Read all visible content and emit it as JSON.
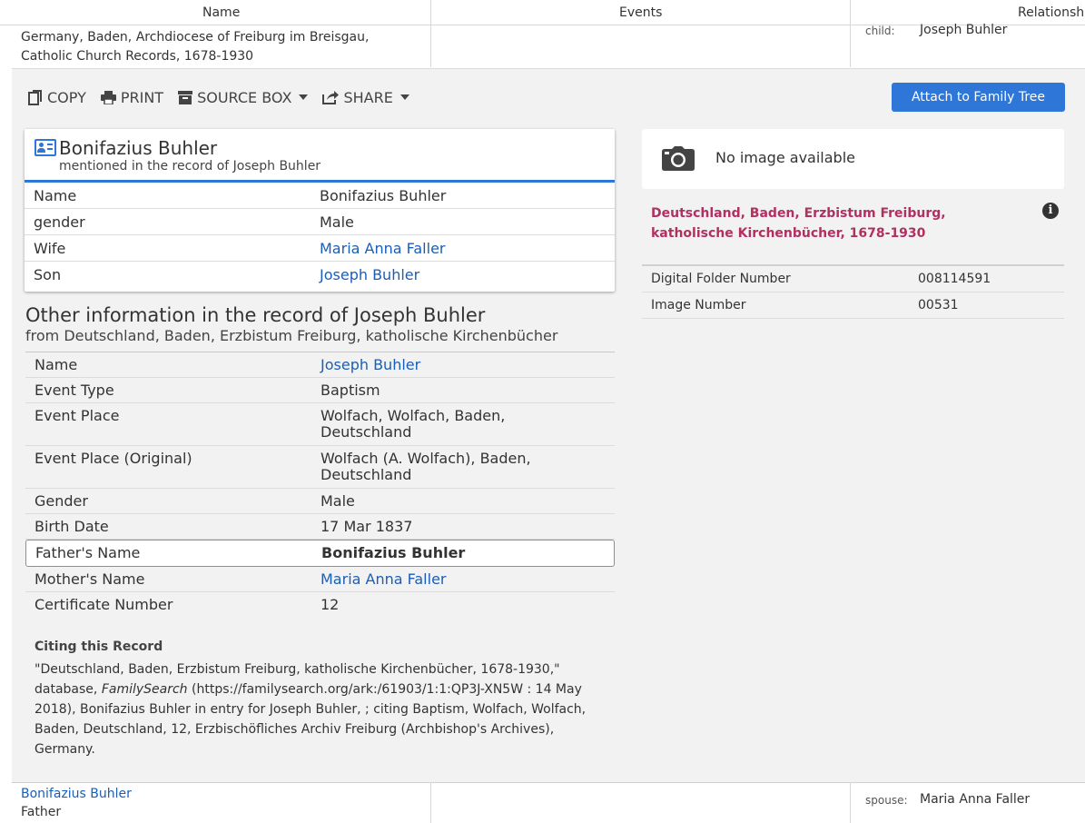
{
  "columns": {
    "name": "Name",
    "events": "Events",
    "relationships": "Relationsh"
  },
  "top_row": {
    "name_line1": "Germany, Baden, Archdiocese of Freiburg im Breisgau,",
    "name_line2": "Catholic Church Records, 1678-1930",
    "relation_label": "child:",
    "relation_value": "Joseph Buhler"
  },
  "toolbar": {
    "copy": "COPY",
    "print": "PRINT",
    "source_box": "SOURCE BOX",
    "share": "SHARE",
    "attach": "Attach to Family Tree"
  },
  "person_card": {
    "title": "Bonifazius Buhler",
    "subtitle": "mentioned in the record of Joseph Buhler",
    "rows": [
      {
        "label": "Name",
        "value": "Bonifazius Buhler",
        "link": false
      },
      {
        "label": "gender",
        "value": "Male",
        "link": false
      },
      {
        "label": "Wife",
        "value": "Maria Anna Faller",
        "link": true
      },
      {
        "label": "Son",
        "value": "Joseph Buhler",
        "link": true
      }
    ]
  },
  "other_info": {
    "title": "Other information in the record of Joseph Buhler",
    "subtitle": "from Deutschland, Baden, Erzbistum Freiburg, katholische Kirchenbücher",
    "rows": [
      {
        "label": "Name",
        "value": "Joseph Buhler",
        "link": true
      },
      {
        "label": "Event Type",
        "value": "Baptism"
      },
      {
        "label": "Event Place",
        "value": "Wolfach, Wolfach, Baden, Deutschland"
      },
      {
        "label": "Event Place (Original)",
        "value": "Wolfach (A. Wolfach), Baden, Deutschland"
      },
      {
        "label": "Gender",
        "value": "Male"
      },
      {
        "label": "Birth Date",
        "value": "17 Mar 1837"
      },
      {
        "label": "Father's Name",
        "value": "Bonifazius Buhler",
        "highlight": true
      },
      {
        "label": "Mother's Name",
        "value": "Maria Anna Faller",
        "link": true
      },
      {
        "label": "Certificate Number",
        "value": "12"
      }
    ]
  },
  "citation": {
    "title": "Citing this Record",
    "part1": "\"Deutschland, Baden, Erzbistum Freiburg, katholische Kirchenbücher, 1678-1930,\" database, ",
    "site": "FamilySearch",
    "part2": " (https://familysearch.org/ark:/61903/1:1:QP3J-XN5W : 14 May 2018), Bonifazius Buhler in entry for Joseph Buhler, ; citing Baptism, Wolfach, Wolfach, Baden, Deutschland, 12, Erzbischöfliches Archiv Freiburg (Archbishop's Archives), Germany."
  },
  "image_box": {
    "text": "No image available"
  },
  "collection": {
    "title": "Deutschland, Baden, Erzbistum Freiburg, katholische Kirchenbücher, 1678-1930"
  },
  "film": [
    {
      "label": "Digital Folder Number",
      "value": "008114591"
    },
    {
      "label": "Image Number",
      "value": "00531"
    }
  ],
  "bottom_row": {
    "name_link": "Bonifazius Buhler",
    "role": "Father",
    "relation_label": "spouse:",
    "relation_value": "Maria Anna Faller"
  }
}
